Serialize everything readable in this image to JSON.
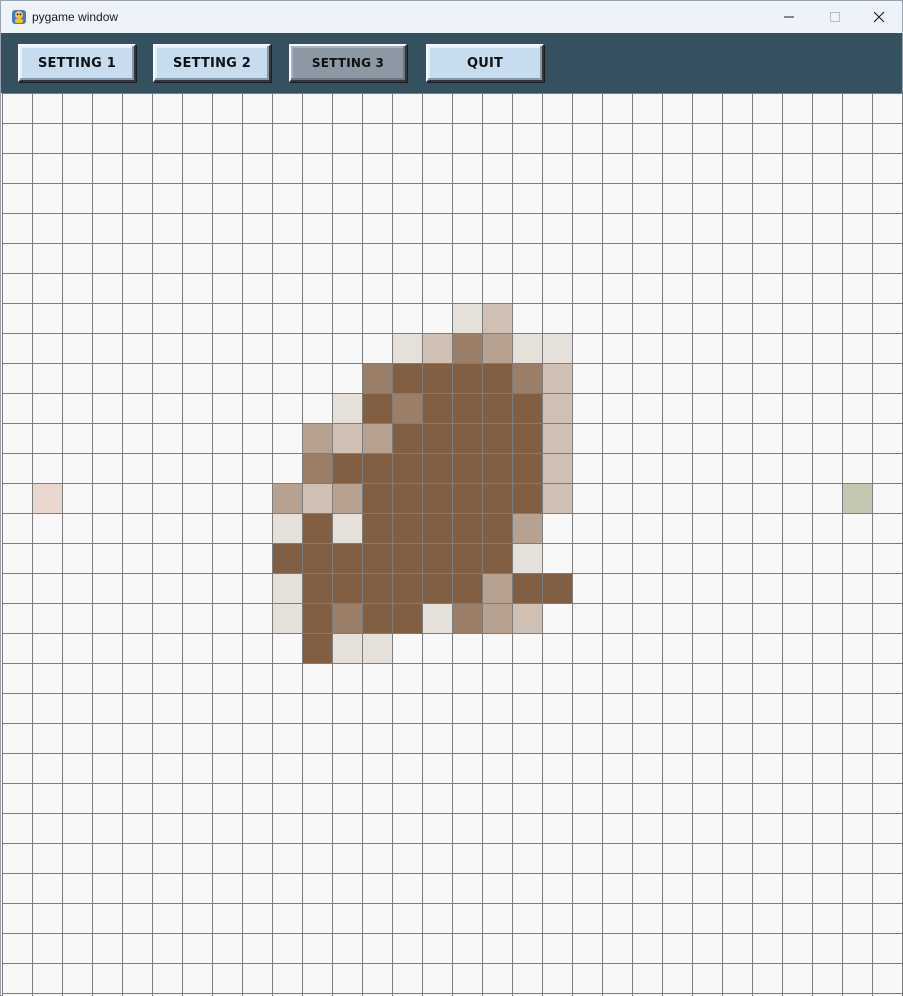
{
  "window": {
    "title": "pygame window",
    "minimize_symbol": "─",
    "maximize_symbol": "☐",
    "close_symbol": "✕"
  },
  "toolbar": {
    "buttons": [
      {
        "label": "SETTING 1",
        "active": false
      },
      {
        "label": "SETTING 2",
        "active": false
      },
      {
        "label": "SETTING 3",
        "active": true
      },
      {
        "label": "QUIT",
        "active": false
      }
    ]
  },
  "canvas": {
    "cols": 30,
    "rows": 30,
    "background": "#f8f8f8",
    "line_color": "#7d7d7d",
    "palette": {
      "1": "#e6e0db",
      "2": "#cfc0b3",
      "3": "#b7a190",
      "4": "#9a7e67",
      "5": "#825f42",
      "6": "#ead8cf",
      "7": "#c3c6b0"
    },
    "cells": [
      [
        7,
        15,
        1
      ],
      [
        7,
        16,
        2
      ],
      [
        8,
        13,
        1
      ],
      [
        8,
        14,
        2
      ],
      [
        8,
        15,
        4
      ],
      [
        8,
        16,
        3
      ],
      [
        8,
        17,
        1
      ],
      [
        8,
        18,
        1
      ],
      [
        9,
        12,
        4
      ],
      [
        9,
        13,
        5
      ],
      [
        9,
        14,
        5
      ],
      [
        9,
        15,
        5
      ],
      [
        9,
        16,
        5
      ],
      [
        9,
        17,
        4
      ],
      [
        9,
        18,
        2
      ],
      [
        10,
        11,
        1
      ],
      [
        10,
        12,
        5
      ],
      [
        10,
        13,
        4
      ],
      [
        10,
        14,
        5
      ],
      [
        10,
        15,
        5
      ],
      [
        10,
        16,
        5
      ],
      [
        10,
        17,
        5
      ],
      [
        10,
        18,
        2
      ],
      [
        11,
        10,
        3
      ],
      [
        11,
        11,
        2
      ],
      [
        11,
        12,
        3
      ],
      [
        11,
        13,
        5
      ],
      [
        11,
        14,
        5
      ],
      [
        11,
        15,
        5
      ],
      [
        11,
        16,
        5
      ],
      [
        11,
        17,
        5
      ],
      [
        11,
        18,
        2
      ],
      [
        12,
        10,
        4
      ],
      [
        12,
        11,
        5
      ],
      [
        12,
        12,
        5
      ],
      [
        12,
        13,
        5
      ],
      [
        12,
        14,
        5
      ],
      [
        12,
        15,
        5
      ],
      [
        12,
        16,
        5
      ],
      [
        12,
        17,
        5
      ],
      [
        12,
        18,
        2
      ],
      [
        13,
        1,
        6
      ],
      [
        13,
        9,
        3
      ],
      [
        13,
        10,
        2
      ],
      [
        13,
        11,
        3
      ],
      [
        13,
        12,
        5
      ],
      [
        13,
        13,
        5
      ],
      [
        13,
        14,
        5
      ],
      [
        13,
        15,
        5
      ],
      [
        13,
        16,
        5
      ],
      [
        13,
        17,
        5
      ],
      [
        13,
        18,
        2
      ],
      [
        13,
        28,
        7
      ],
      [
        14,
        9,
        1
      ],
      [
        14,
        10,
        5
      ],
      [
        14,
        11,
        1
      ],
      [
        14,
        12,
        5
      ],
      [
        14,
        13,
        5
      ],
      [
        14,
        14,
        5
      ],
      [
        14,
        15,
        5
      ],
      [
        14,
        16,
        5
      ],
      [
        14,
        17,
        3
      ],
      [
        15,
        9,
        5
      ],
      [
        15,
        10,
        5
      ],
      [
        15,
        11,
        5
      ],
      [
        15,
        12,
        5
      ],
      [
        15,
        13,
        5
      ],
      [
        15,
        14,
        5
      ],
      [
        15,
        15,
        5
      ],
      [
        15,
        16,
        5
      ],
      [
        15,
        17,
        1
      ],
      [
        16,
        9,
        1
      ],
      [
        16,
        10,
        5
      ],
      [
        16,
        11,
        5
      ],
      [
        16,
        12,
        5
      ],
      [
        16,
        13,
        5
      ],
      [
        16,
        14,
        5
      ],
      [
        16,
        15,
        5
      ],
      [
        16,
        16,
        3
      ],
      [
        16,
        17,
        5
      ],
      [
        16,
        18,
        5
      ],
      [
        17,
        9,
        1
      ],
      [
        17,
        10,
        5
      ],
      [
        17,
        11,
        4
      ],
      [
        17,
        12,
        5
      ],
      [
        17,
        13,
        5
      ],
      [
        17,
        14,
        1
      ],
      [
        17,
        15,
        4
      ],
      [
        17,
        16,
        3
      ],
      [
        17,
        17,
        2
      ],
      [
        18,
        10,
        5
      ],
      [
        18,
        11,
        1
      ],
      [
        18,
        12,
        1
      ]
    ]
  }
}
